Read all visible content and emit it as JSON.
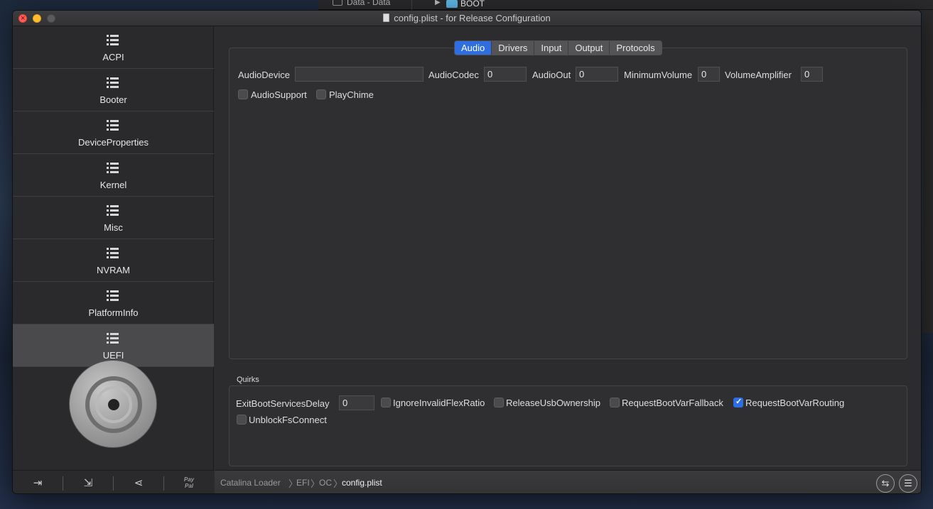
{
  "background": {
    "finder_disk_label": "Data - Data",
    "finder_folder_label": "BOOT"
  },
  "window": {
    "title": "config.plist - for Release Configuration"
  },
  "sidebar": {
    "items": [
      {
        "label": "ACPI"
      },
      {
        "label": "Booter"
      },
      {
        "label": "DeviceProperties"
      },
      {
        "label": "Kernel"
      },
      {
        "label": "Misc"
      },
      {
        "label": "NVRAM"
      },
      {
        "label": "PlatformInfo"
      },
      {
        "label": "UEFI",
        "selected": true
      }
    ],
    "toolbar": {
      "paypal_line1": "Pay",
      "paypal_line2": "Pal"
    }
  },
  "tabs": [
    {
      "label": "Audio",
      "active": true
    },
    {
      "label": "Drivers"
    },
    {
      "label": "Input"
    },
    {
      "label": "Output"
    },
    {
      "label": "Protocols"
    }
  ],
  "audio": {
    "audio_device_label": "AudioDevice",
    "audio_device_value": "",
    "audio_codec_label": "AudioCodec",
    "audio_codec_value": "0",
    "audio_out_label": "AudioOut",
    "audio_out_value": "0",
    "minimum_volume_label": "MinimumVolume",
    "minimum_volume_value": "0",
    "volume_amplifier_label": "VolumeAmplifier",
    "volume_amplifier_value": "0",
    "audio_support_label": "AudioSupport",
    "audio_support_checked": false,
    "play_chime_label": "PlayChime",
    "play_chime_checked": false
  },
  "quirks": {
    "title": "Quirks",
    "exit_boot_services_delay_label": "ExitBootServicesDelay",
    "exit_boot_services_delay_value": "0",
    "ignore_invalid_flex_ratio_label": "IgnoreInvalidFlexRatio",
    "release_usb_ownership_label": "ReleaseUsbOwnership",
    "request_boot_var_fallback_label": "RequestBootVarFallback",
    "request_boot_var_routing_label": "RequestBootVarRouting",
    "request_boot_var_routing_checked": true,
    "unblock_fs_connect_label": "UnblockFsConnect"
  },
  "pathbar": {
    "crumbs": [
      "Catalina Loader",
      "EFI",
      "OC",
      "config.plist"
    ]
  },
  "colors": {
    "accent": "#2f6ee0",
    "close": "#ff5f57",
    "minimize": "#febc2e"
  }
}
